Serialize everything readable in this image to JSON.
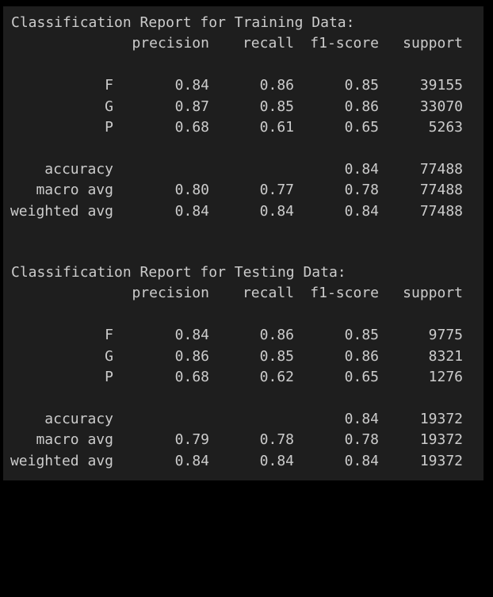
{
  "training": {
    "title": "Classification Report for Training Data:",
    "headers": {
      "precision": "precision",
      "recall": "recall",
      "f1": "f1-score",
      "support": "support"
    },
    "rows": [
      {
        "label": "F",
        "precision": "0.84",
        "recall": "0.86",
        "f1": "0.85",
        "support": "39155"
      },
      {
        "label": "G",
        "precision": "0.87",
        "recall": "0.85",
        "f1": "0.86",
        "support": "33070"
      },
      {
        "label": "P",
        "precision": "0.68",
        "recall": "0.61",
        "f1": "0.65",
        "support": "5263"
      }
    ],
    "accuracy": {
      "label": "accuracy",
      "f1": "0.84",
      "support": "77488"
    },
    "macro": {
      "label": "macro avg",
      "precision": "0.80",
      "recall": "0.77",
      "f1": "0.78",
      "support": "77488"
    },
    "weighted": {
      "label": "weighted avg",
      "precision": "0.84",
      "recall": "0.84",
      "f1": "0.84",
      "support": "77488"
    }
  },
  "testing": {
    "title": "Classification Report for Testing Data:",
    "headers": {
      "precision": "precision",
      "recall": "recall",
      "f1": "f1-score",
      "support": "support"
    },
    "rows": [
      {
        "label": "F",
        "precision": "0.84",
        "recall": "0.86",
        "f1": "0.85",
        "support": "9775"
      },
      {
        "label": "G",
        "precision": "0.86",
        "recall": "0.85",
        "f1": "0.86",
        "support": "8321"
      },
      {
        "label": "P",
        "precision": "0.68",
        "recall": "0.62",
        "f1": "0.65",
        "support": "1276"
      }
    ],
    "accuracy": {
      "label": "accuracy",
      "f1": "0.84",
      "support": "19372"
    },
    "macro": {
      "label": "macro avg",
      "precision": "0.79",
      "recall": "0.78",
      "f1": "0.78",
      "support": "19372"
    },
    "weighted": {
      "label": "weighted avg",
      "precision": "0.84",
      "recall": "0.84",
      "f1": "0.84",
      "support": "19372"
    }
  },
  "colors": {
    "background": "#1e1e1e",
    "frame": "#000000",
    "text": "#cccccc"
  }
}
